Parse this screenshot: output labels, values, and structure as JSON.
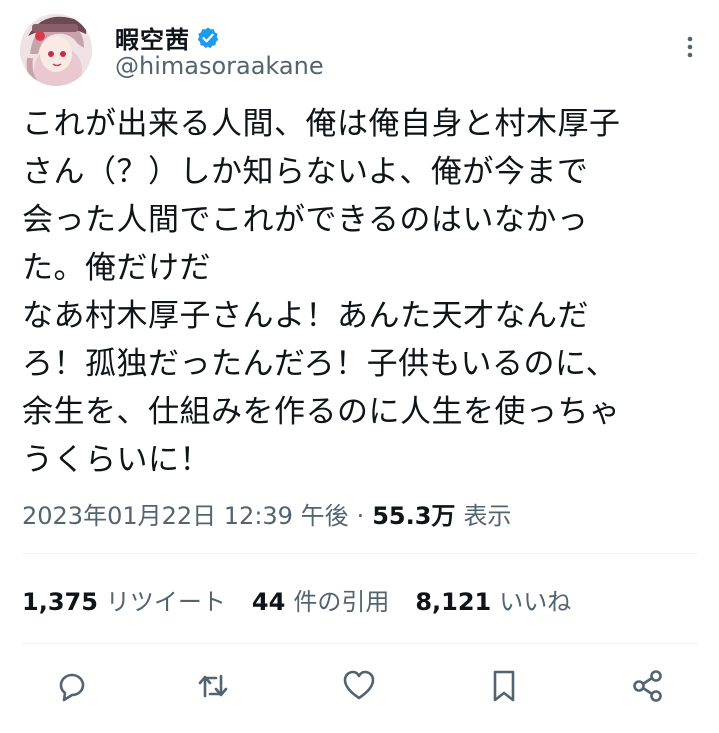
{
  "author": {
    "display_name": "暇空茜",
    "handle": "@himasoraakane",
    "verified": true,
    "avatar_icon": "avatar-anime-girl-with-hat"
  },
  "tweet": {
    "text": "これが出来る人間、俺は俺自身と村木厚子\nさん（？）しか知らないよ、俺が今まで\n会った人間でこれができるのはいなかっ\nた。俺だけだ\nなあ村木厚子さんよ！あんた天才なんだ\nろ！孤独だったんだろ！子供もいるのに、\n余生を、仕組みを作るのに人生を使っちゃ\nうくらいに！",
    "timestamp": "2023年01月22日 12:39 午後",
    "separator": "·",
    "views_count": "55.3万",
    "views_label": "表示"
  },
  "stats": {
    "retweets_count": "1,375",
    "retweets_label": "リツイート",
    "quotes_count": "44",
    "quotes_label": "件の引用",
    "likes_count": "8,121",
    "likes_label": "いいね"
  },
  "actions": {
    "reply_icon": "reply-icon",
    "retweet_icon": "retweet-icon",
    "like_icon": "like-icon",
    "bookmark_icon": "bookmark-icon",
    "share_icon": "share-icon"
  },
  "colors": {
    "text": "#0f1419",
    "secondary": "#536471",
    "verified": "#1d9bf0",
    "divider": "#eff3f4"
  }
}
